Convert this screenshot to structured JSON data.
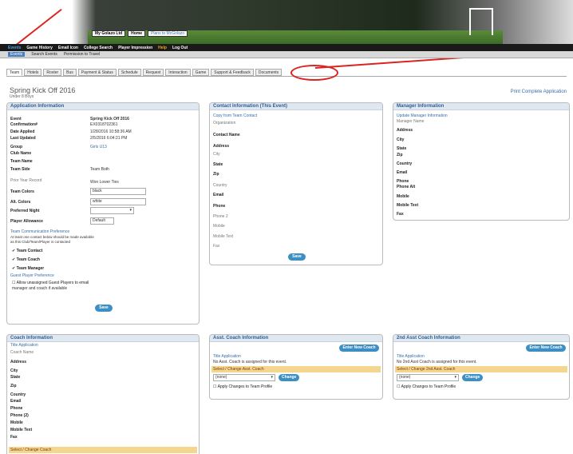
{
  "banner": {
    "login_label": "My Golazo Ltd",
    "logout_label": "Home",
    "user_link": "Plans to McGolazo"
  },
  "nav": [
    "Events",
    "Game History",
    "Email Icon",
    "College Search",
    "Player Impression",
    "Help",
    "Log Out"
  ],
  "subnav": [
    "Events",
    "Search Events",
    "Permission to Travel"
  ],
  "tabs": [
    "Team",
    "Hotels",
    "Roster",
    "Bus",
    "Payment & Status",
    "Schedule",
    "Request",
    "Interaction",
    "Game",
    "Support & Feedback",
    "Documents"
  ],
  "page": {
    "title": "Spring Kick Off 2016",
    "subtitle": "Under 8 Boys",
    "complete_link": "Print Complete Application"
  },
  "app_info": {
    "header": "Application Information",
    "event_label": "Event",
    "event_value": "Spring Kick Off 2016",
    "confirmation_label": "Confirmation#",
    "confirmation_value": "EX0318702361",
    "date_applied_label": "Date Applied",
    "date_applied_value": "1/28/2016 10:58:36 AM",
    "last_updated_label": "Last Updated",
    "last_updated_value": "2/5/2016 6:04:21 PM",
    "group_label": "Group",
    "group_value": "Girls U13",
    "club_label": "Club Name",
    "team_label": "Team Name",
    "side_label": "Team Side",
    "side_value": "Team Both",
    "prior_label": "Prior Year Record",
    "prior_value": "Won Lower Ties",
    "colors_label": "Team Colors",
    "colors_value": "black",
    "alt_label": "Alt. Colors",
    "alt_value": "white",
    "night_label": "Preferred Night",
    "guest_label": "Player Allowance",
    "guest_value": "Default",
    "comm_link": "Team Communication Preference",
    "comm_note": "At least one contact below should be made available",
    "comm_note2": "as this Club/Team/Player is contacted",
    "contact_cb": "Team Contact",
    "coach_cb": "Team Coach",
    "manager_cb": "Team Manager",
    "guest_pref_link": "Guest Player Preference",
    "guest_pref_note": "Allow unassigned Guest Players to email",
    "guest_pref_note2": "manager and coach if available",
    "save": "Save"
  },
  "contact_info": {
    "header": "Contact Information (This Event)",
    "copy_link": "Copy from Team Contact",
    "org": "Organization",
    "name": "Contact Name",
    "address": "Address",
    "city": "City",
    "state": "State",
    "zip": "Zip",
    "country": "Country",
    "email": "Email",
    "phone": "Phone",
    "phone2": "Phone 2",
    "mobile": "Mobile",
    "mobile_text": "Mobile Text",
    "fax": "Fax",
    "save": "Save"
  },
  "manager_info": {
    "header": "Manager Information",
    "update_link": "Update Manager Information",
    "name": "Manager Name",
    "address": "Address",
    "city": "City",
    "state": "State",
    "zip": "Zip",
    "country": "Country",
    "email": "Email",
    "phone": "Phone",
    "phone_alt": "Phone Alt",
    "mobile": "Mobile",
    "mobile_text": "Mobile Text",
    "fax": "Fax"
  },
  "coach_info": {
    "header": "Coach Information",
    "title_link": "Title Application",
    "name": "Coach Name",
    "address": "Address",
    "city": "City",
    "state": "State",
    "zip": "Zip",
    "country": "Country",
    "email": "Email",
    "phone": "Phone",
    "phone2": "Phone (2)",
    "mobile": "Mobile",
    "mobile_text": "Mobile Text",
    "fax": "Fax",
    "select_bar": "Select / Change Coach"
  },
  "asst_coach": {
    "header": "Asst. Coach Information",
    "new_btn": "Enter New Coach",
    "title_link": "Title Application",
    "note": "No Asst. Coach is assigned for this event.",
    "select_bar": "Select / Change Asst. Coach",
    "select_value": "(none)",
    "change_btn": "Change",
    "apply_cb": "Apply Changes to Team Profile"
  },
  "second_asst": {
    "header": "2nd Asst Coach Information",
    "new_btn": "Enter New Coach",
    "title_link": "Title Application",
    "note": "No 2nd Asst Coach is assigned for this event.",
    "select_bar": "Select / Change 2nd Asst. Coach",
    "select_value": "(none)",
    "change_btn": "Change",
    "apply_cb": "Apply Changes to Team Profile"
  }
}
